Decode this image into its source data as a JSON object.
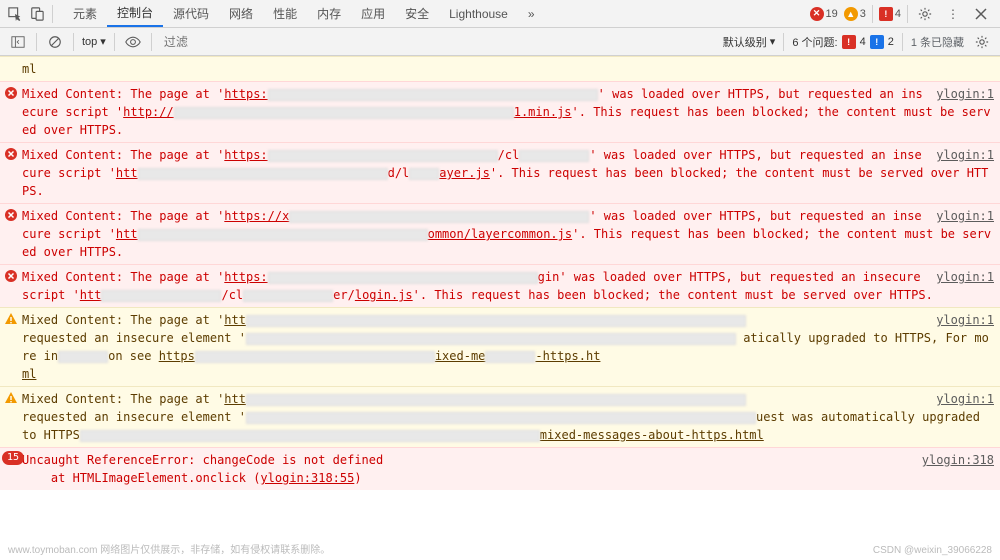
{
  "tabs": [
    "元素",
    "控制台",
    "源代码",
    "网络",
    "性能",
    "内存",
    "应用",
    "安全",
    "Lighthouse"
  ],
  "activeTab": 1,
  "topBadges": {
    "errors": 19,
    "warnings": 3,
    "issues": 4
  },
  "toolbar": {
    "context": "top",
    "filterPlaceholder": "过滤",
    "levelLabel": "默认级别",
    "issuesLabel": "6 个问题:",
    "issueRed": 4,
    "issueBlue": 2,
    "hiddenLabel": "1 条已隐藏"
  },
  "firstLine": "ml",
  "messages": [
    {
      "type": "err",
      "src": "ylogin:1",
      "text": "Mixed Content: The page at 'https: ' was loaded over HTTPS, but requested an insecure script 'http:// 1.min.js'. This request has been blocked; the content must be served over HTTPS."
    },
    {
      "type": "err",
      "src": "ylogin:1",
      "text": "Mixed Content: The page at 'https: /clo ' was loaded over HTTPS, but requested an insecure script 'http d/la ayer.js'. This request has been blocked; the content must be served over HTTPS."
    },
    {
      "type": "err",
      "src": "ylogin:1",
      "text": "Mixed Content: The page at 'https://x ' was loaded over HTTPS, but requested an insecure script 'http ommon/layercommon.js'. This request has been blocked; the content must be served over HTTPS."
    },
    {
      "type": "err",
      "src": "ylogin:1",
      "text": "Mixed Content: The page at 'https: gin' was loaded over HTTPS, but requested an insecure script 'htt /cl er/ login.js'. This request has been blocked; the content must be served over HTTPS."
    },
    {
      "type": "warn",
      "src": "ylogin:1",
      "text": "Mixed Content: The page at 'htt requested an insecure element ' atically upgraded to HTTPS, For more in on see https ixed-me -https.ht ml"
    },
    {
      "type": "warn",
      "src": "ylogin:1",
      "text": "Mixed Content: The page at 'htt requested an insecure element ' uest was automatically upgraded to HTTPS mixed-messages-about-https.html"
    },
    {
      "type": "err2",
      "count": 15,
      "src": "ylogin:318",
      "text": "Uncaught ReferenceError: changeCode is not defined",
      "stack": "at HTMLImageElement.onclick (ylogin:318:55)"
    }
  ],
  "watermark": "www.toymoban.com 网络图片仅供展示，非存储，如有侵权请联系删除。",
  "watermark2": "CSDN @weixin_39066228"
}
